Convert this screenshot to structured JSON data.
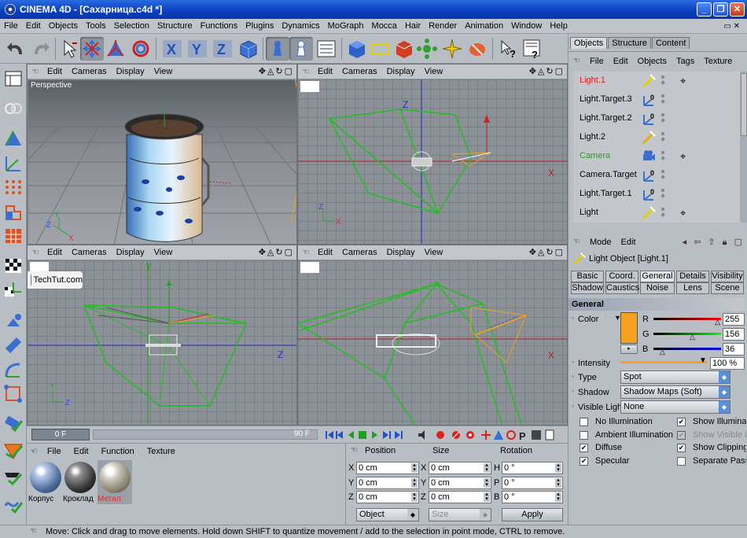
{
  "window": {
    "title": "CINEMA 4D - [Сахарница.c4d *]"
  },
  "menu": [
    "File",
    "Edit",
    "Objects",
    "Tools",
    "Selection",
    "Structure",
    "Functions",
    "Plugins",
    "Dynamics",
    "MoGraph",
    "Mocca",
    "Hair",
    "Render",
    "Animation",
    "Window",
    "Help"
  ],
  "viewport": {
    "menu": [
      "Edit",
      "Cameras",
      "Display",
      "View"
    ],
    "perspective_label": "Perspective",
    "axis_labels": {
      "x": "X",
      "y": "Y",
      "z": "Z"
    }
  },
  "watermark": "TechTut.com",
  "timeline": {
    "current_frame": "0 F",
    "max_frame": "90 F"
  },
  "materials": {
    "menu": [
      "File",
      "Edit",
      "Function",
      "Texture"
    ],
    "items": [
      {
        "name": "Корпус",
        "color": "#000000"
      },
      {
        "name": "Кроклад",
        "color": "#000000"
      },
      {
        "name": "Метал",
        "color": "#ff2020"
      }
    ]
  },
  "coordinates": {
    "headers": [
      "Position",
      "Size",
      "Rotation"
    ],
    "rows": [
      {
        "p_axis": "X",
        "p": "0 cm",
        "s_axis": "X",
        "s": "0 cm",
        "r_axis": "H",
        "r": "0 °"
      },
      {
        "p_axis": "Y",
        "p": "0 cm",
        "s_axis": "Y",
        "s": "0 cm",
        "r_axis": "P",
        "r": "0 °"
      },
      {
        "p_axis": "Z",
        "p": "0 cm",
        "s_axis": "Z",
        "s": "0 cm",
        "r_axis": "B",
        "r": "0 °"
      }
    ],
    "mode": "Object",
    "size_mode": "Size",
    "apply": "Apply"
  },
  "status": "Move: Click and drag to move elements. Hold down SHIFT to quantize movement / add to the selection in point mode, CTRL to remove.",
  "objects_panel": {
    "tabs": [
      "Objects",
      "Structure",
      "Content"
    ],
    "menu": [
      "File",
      "Edit",
      "Objects",
      "Tags",
      "Texture"
    ],
    "items": [
      {
        "name": "Light.1",
        "color": "#e02020",
        "target": true
      },
      {
        "name": "Light.Target.3",
        "color": "#000000",
        "target": false
      },
      {
        "name": "Light.Target.2",
        "color": "#000000",
        "target": false
      },
      {
        "name": "Light.2",
        "color": "#000000",
        "target": false
      },
      {
        "name": "Camera",
        "color": "#20a020",
        "target": true
      },
      {
        "name": "Camera.Target",
        "color": "#000000",
        "target": false
      },
      {
        "name": "Light.Target.1",
        "color": "#000000",
        "target": false
      },
      {
        "name": "Light",
        "color": "#000000",
        "target": true
      }
    ]
  },
  "attributes": {
    "menu": [
      "Mode",
      "Edit"
    ],
    "title": "Light Object [Light.1]",
    "tabs_row1": [
      "Basic",
      "Coord.",
      "General",
      "Details",
      "Visibility"
    ],
    "tabs_row2": [
      "Shadow",
      "Caustics",
      "Noise",
      "Lens",
      "Scene"
    ],
    "active_tab": "General",
    "section": "General",
    "color_label": "Color",
    "color_value": "#f6a020",
    "rgb": [
      {
        "ch": "R",
        "value": "255"
      },
      {
        "ch": "G",
        "value": "156"
      },
      {
        "ch": "B",
        "value": "36"
      }
    ],
    "intensity_label": "Intensity",
    "intensity": "100 %",
    "type_label": "Type",
    "type": "Spot",
    "shadow_label": "Shadow",
    "shadow": "Shadow Maps (Soft)",
    "visible_light_label": "Visible Light",
    "visible_light": "None",
    "checks_left": [
      {
        "label": "No Illumination",
        "checked": false
      },
      {
        "label": "Ambient Illumination",
        "checked": false
      },
      {
        "label": "Diffuse",
        "checked": true
      },
      {
        "label": "Specular",
        "checked": true
      }
    ],
    "checks_right": [
      {
        "label": "Show Illuminati",
        "checked": true,
        "enabled": true
      },
      {
        "label": "Show Visible L",
        "checked": true,
        "enabled": false
      },
      {
        "label": "Show Clipping",
        "checked": true,
        "enabled": true
      },
      {
        "label": "Separate Pass",
        "checked": false,
        "enabled": true
      }
    ]
  }
}
